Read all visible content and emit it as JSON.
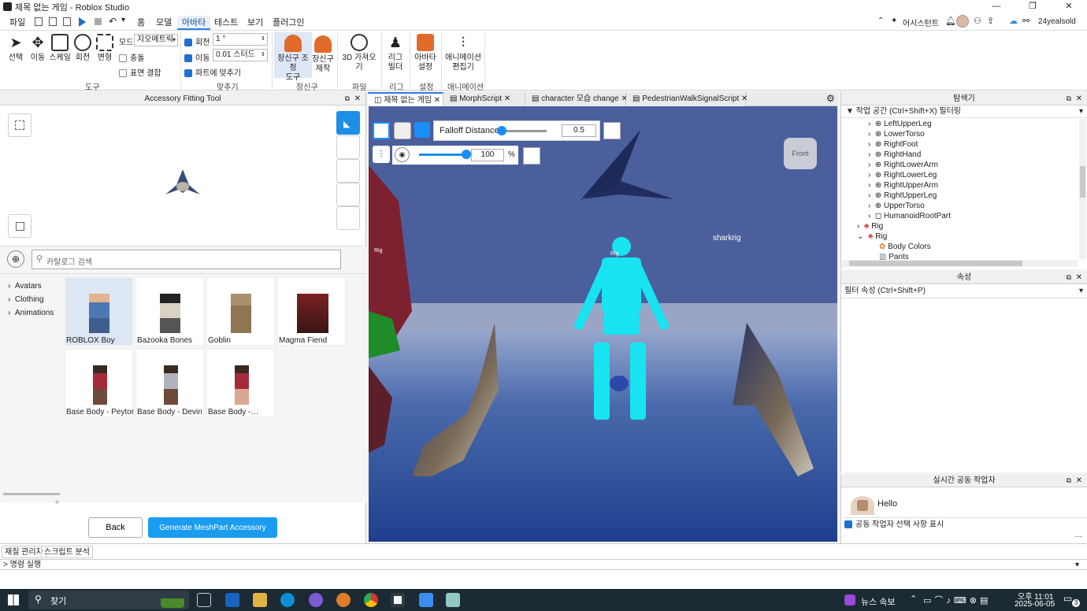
{
  "titlebar": {
    "title": "제목 없는 게임 - Roblox Studio"
  },
  "menu": {
    "file": "파일",
    "tabs": [
      "홈",
      "모델",
      "아바타",
      "테스트",
      "보기",
      "플러그인"
    ],
    "active_tab": "아바타",
    "assistant": "어시스턴트",
    "user": "24yealsold"
  },
  "ribbon": {
    "tools": {
      "select": "선택",
      "move": "이동",
      "scale": "스케일",
      "rotate": "회전",
      "transform": "변형",
      "group": "도구"
    },
    "mode_label": "모드:",
    "mode_value": "지오메트릭",
    "collision": "충돌",
    "surface_join": "표면 결합",
    "rotate_label": "회전",
    "rotate_value": "1 °",
    "move_label": "이동",
    "move_value": "0.01 스터드",
    "fit_parts": "파트에 맞추기",
    "snap_group": "맞추기",
    "acc_fit_line1": "장신구 조정",
    "acc_fit_line2": "도구",
    "acc_make_line1": "장신구",
    "acc_make_line2": "제작",
    "acc_group": "장신구",
    "import3d": "3D 가져오기",
    "file_group": "파일",
    "rig_line1": "리그",
    "rig_line2": "빌더",
    "rig_group": "리그",
    "avatar_line1": "아바타",
    "avatar_line2": "설정",
    "settings_group": "설정",
    "anim_line1": "애니메이션",
    "anim_line2": "편집기",
    "anim_group": "애니메이션"
  },
  "aft": {
    "title": "Accessory Fitting Tool",
    "search_placeholder": "카탈로그 검색",
    "categories": [
      "Avatars",
      "Clothing",
      "Animations"
    ],
    "items": [
      "ROBLOX Boy",
      "Bazooka Bones",
      "Goblin",
      "Magma Fiend",
      "Base Body - Peyton",
      "Base Body - Devin",
      "Base Body -…"
    ],
    "back": "Back",
    "generate": "Generate MeshPart Accessory"
  },
  "viewport": {
    "tabs": [
      "제목 없는 게임",
      "MorphScript",
      "character 모습 change",
      "PedestrianWalkSignalScript"
    ],
    "falloff_label": "Falloff Distance",
    "falloff_value": "0.5",
    "opacity_value": "100",
    "opacity_unit": "%",
    "view_cube": "Front",
    "label_sharkrig": "sharkrig",
    "label_rig": "Rig"
  },
  "explorer": {
    "title": "탐색기",
    "filter": "작업 공간 (Ctrl+Shift+X) 필터링",
    "nodes": [
      "LeftUpperLeg",
      "LowerTorso",
      "RightFoot",
      "RightHand",
      "RightLowerArm",
      "RightLowerLeg",
      "RightUpperArm",
      "RightUpperLeg",
      "UpperTorso",
      "HumanoidRootPart",
      "Rig",
      "Rig",
      "Body Colors",
      "Pants"
    ]
  },
  "properties": {
    "title": "속성",
    "filter": "필터 속성 (Ctrl+Shift+P)"
  },
  "collab": {
    "title": "실시간 공동 작업자",
    "hello": "Hello",
    "show_selection": "공동 작업자 선택 사항 표시"
  },
  "bottom": {
    "tab1": "재질 관리자",
    "tab2": "스크립트 분석",
    "command": "명령 실행"
  },
  "taskbar": {
    "search": "찾기",
    "news": "뉴스 속보",
    "ampm": "오후 11:01",
    "date": "2025-06-05",
    "notif": "3"
  }
}
